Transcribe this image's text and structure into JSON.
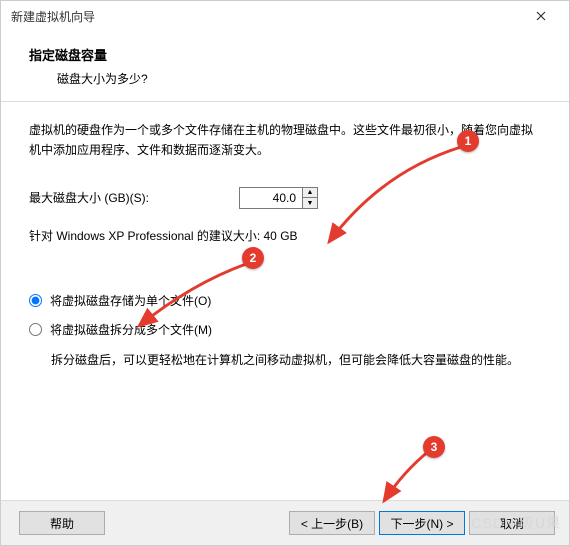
{
  "window": {
    "title": "新建虚拟机向导"
  },
  "header": {
    "title": "指定磁盘容量",
    "subtitle": "磁盘大小为多少?"
  },
  "content": {
    "description": "虚拟机的硬盘作为一个或多个文件存储在主机的物理磁盘中。这些文件最初很小，随着您向虚拟机中添加应用程序、文件和数据而逐渐变大。",
    "max_size_label": "最大磁盘大小 (GB)(S):",
    "max_size_value": "40.0",
    "recommendation": "针对 Windows XP Professional 的建议大小: 40 GB",
    "radio_single": "将虚拟磁盘存储为单个文件(O)",
    "radio_split": "将虚拟磁盘拆分成多个文件(M)",
    "split_note": "拆分磁盘后，可以更轻松地在计算机之间移动虚拟机，但可能会降低大容量磁盘的性能。"
  },
  "footer": {
    "help": "帮助",
    "back": "< 上一步(B)",
    "next": "下一步(N) >",
    "cancel": "取消"
  },
  "annotations": {
    "b1": "1",
    "b2": "2",
    "b3": "3"
  },
  "watermark": "CSDN 吸U果"
}
